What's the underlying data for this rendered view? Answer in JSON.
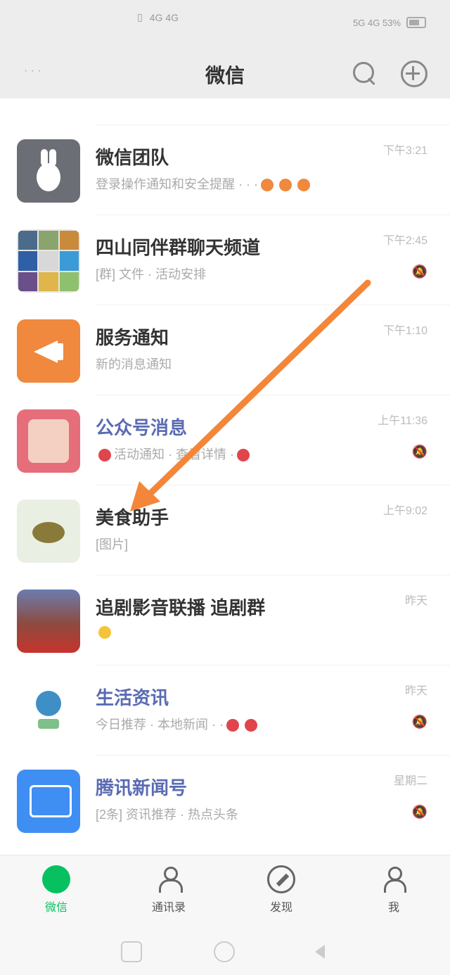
{
  "status_bar": {
    "network_text": "4G 4G",
    "right_text": "5G 4G 53%"
  },
  "header": {
    "left_text": "· · ·",
    "title": "微信",
    "icons": [
      "search-icon",
      "add-icon"
    ]
  },
  "chats": [
    {
      "name": "",
      "preview": "",
      "time": "",
      "avatar": "brown"
    },
    {
      "name": "微信团队",
      "preview": "登录操作通知和安全提醒 · · ·",
      "time": "下午3:21",
      "avatar": "rabbit"
    },
    {
      "name": "四山同伴群聊天频道",
      "preview": "[群] 文件 · 活动安排",
      "time": "下午2:45",
      "avatar": "grid",
      "muted": true
    },
    {
      "name": "服务通知",
      "preview": "新的消息通知",
      "time": "下午1:10",
      "avatar": "orange"
    },
    {
      "name": "公众号消息",
      "preview": "活动通知 · 查看详情 ·",
      "time": "上午11:36",
      "avatar": "pink",
      "blue_name": true,
      "muted": true
    },
    {
      "name": "美食助手",
      "preview": "[图片]",
      "time": "上午9:02",
      "avatar": "food"
    },
    {
      "name": "追剧影音联播 追剧群",
      "preview": "",
      "time": "昨天",
      "avatar": "people"
    },
    {
      "name": "生活资讯",
      "preview": "今日推荐 · 本地新闻 · ·",
      "time": "昨天",
      "avatar": "globe",
      "blue_name": true,
      "muted": true
    },
    {
      "name": "腾讯新闻号",
      "preview": "[2条] 资讯推荐 · 热点头条",
      "time": "星期二",
      "avatar": "blue",
      "blue_name": true,
      "muted": true
    }
  ],
  "tabs": [
    {
      "label": "微信",
      "active": true
    },
    {
      "label": "通讯录",
      "active": false
    },
    {
      "label": "发现",
      "active": false
    },
    {
      "label": "我",
      "active": false
    }
  ],
  "colors": {
    "accent_green": "#07c160",
    "annotation_orange": "#f4863a"
  }
}
